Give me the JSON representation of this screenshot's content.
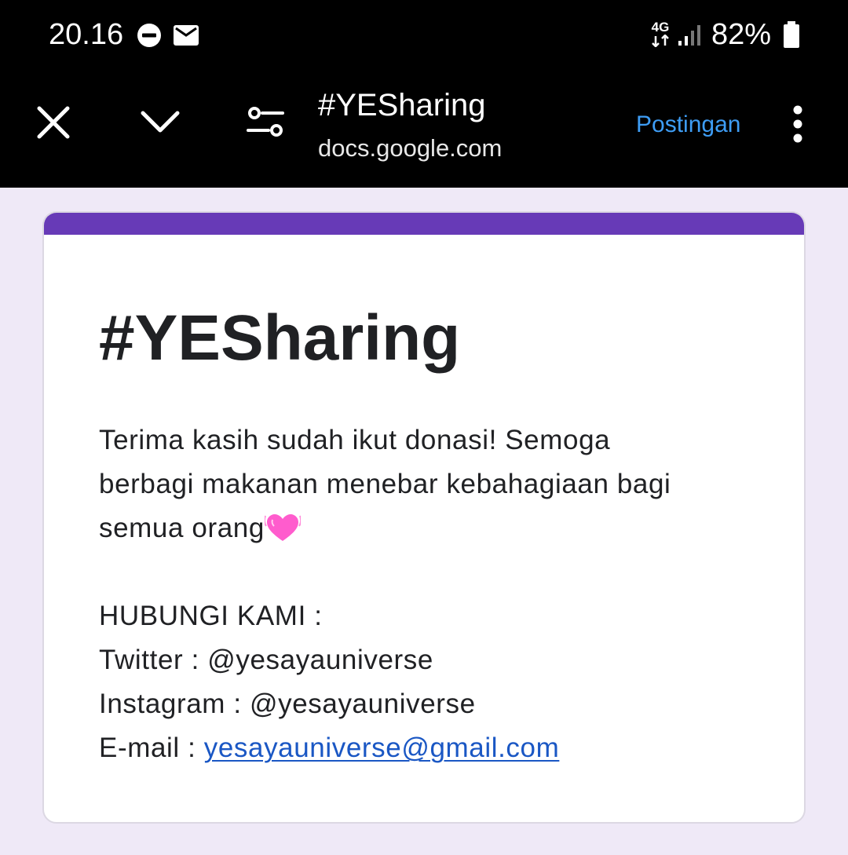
{
  "status_bar": {
    "time": "20.16",
    "network": "4G",
    "battery": "82%",
    "icons": [
      "do-not-disturb-icon",
      "mail-icon",
      "signal-icon",
      "battery-icon"
    ]
  },
  "toolbar": {
    "title": "#YESharing",
    "domain": "docs.google.com",
    "action_label": "Postingan",
    "icons": [
      "close-icon",
      "chevron-down-icon",
      "settings-sliders-icon",
      "more-vert-icon"
    ],
    "action_color": "#3e9df5"
  },
  "form": {
    "accent_color": "#673ab7",
    "title": "#YESharing",
    "description_lines": [
      "Terima kasih sudah ikut donasi! Semoga",
      "berbagi makanan menebar kebahagiaan bagi",
      "semua orang"
    ],
    "description_emoji": "heart-icon",
    "contact_heading": "HUBUNGI KAMI :",
    "twitter": "Twitter : @yesayauniverse",
    "instagram": "Instagram : @yesayauniverse",
    "email_prefix": "E-mail : ",
    "email": "yesayauniverse@gmail.com",
    "link_color": "#1a57c4"
  }
}
